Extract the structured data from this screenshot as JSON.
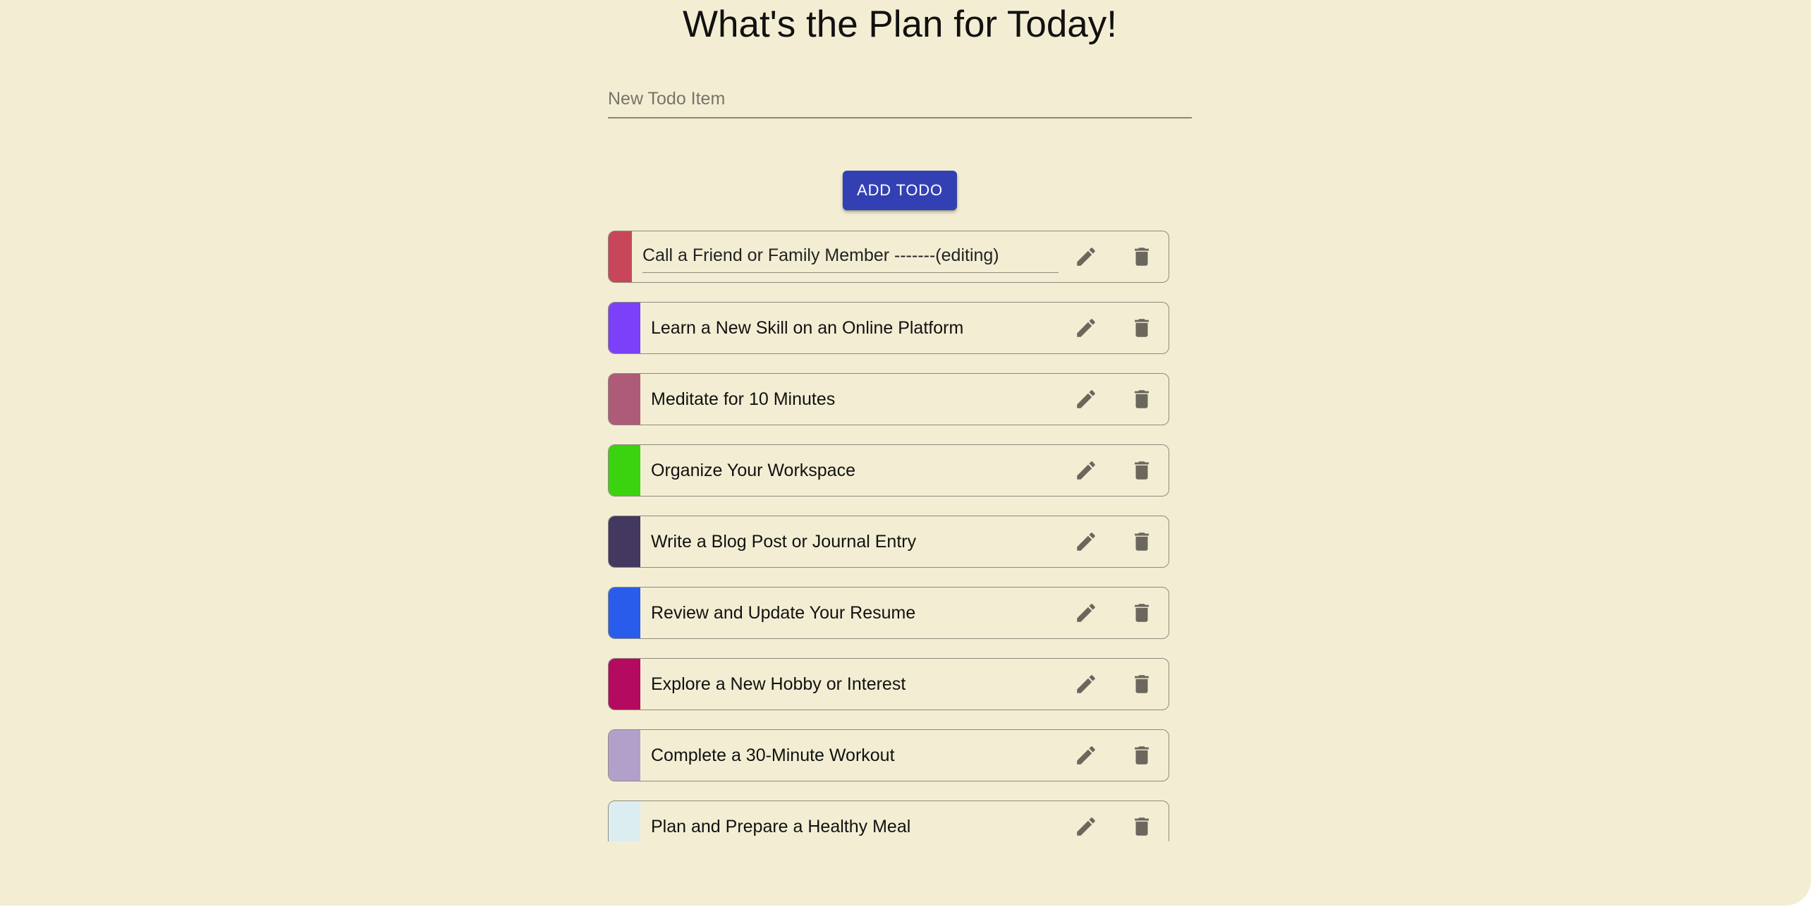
{
  "header": {
    "title": "What's the Plan for Today!"
  },
  "new_todo": {
    "placeholder": "New Todo Item",
    "value": "",
    "add_label": "ADD TODO"
  },
  "todos": [
    {
      "text": "Call a Friend or Family Member -------(editing)",
      "color": "#c8465a",
      "editing": true
    },
    {
      "text": "Learn a New Skill on an Online Platform",
      "color": "#7b40f7",
      "editing": false
    },
    {
      "text": "Meditate for 10 Minutes",
      "color": "#ad5b79",
      "editing": false
    },
    {
      "text": "Organize Your Workspace",
      "color": "#3bd20f",
      "editing": false
    },
    {
      "text": "Write a Blog Post or Journal Entry",
      "color": "#433860",
      "editing": false
    },
    {
      "text": "Review and Update Your Resume",
      "color": "#2a5cec",
      "editing": false
    },
    {
      "text": "Explore a New Hobby or Interest",
      "color": "#b40a60",
      "editing": false
    },
    {
      "text": "Complete a 30-Minute Workout",
      "color": "#b3a0ca",
      "editing": false
    },
    {
      "text": "Plan and Prepare a Healthy Meal",
      "color": "#dcedf2",
      "editing": false
    }
  ],
  "icons": {
    "edit": "pencil-icon",
    "delete": "trash-icon"
  }
}
